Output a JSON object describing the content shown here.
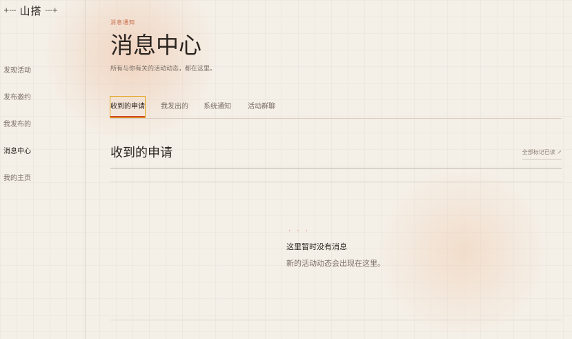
{
  "app": {
    "logo": "山搭",
    "logo_left": "+---",
    "logo_right": "---+"
  },
  "sidebar": {
    "items": [
      {
        "label": "发现活动",
        "active": false
      },
      {
        "label": "发布邀约",
        "active": false
      },
      {
        "label": "我发布的",
        "active": false
      },
      {
        "label": "消息中心",
        "active": true
      },
      {
        "label": "我的主页",
        "active": false
      }
    ]
  },
  "header": {
    "eyebrow": "消息通知",
    "title": "消息中心",
    "subtitle": "所有与你有关的活动动态，都在这里。"
  },
  "tabs": [
    {
      "label": "收到的申请",
      "active": true
    },
    {
      "label": "我发出的",
      "active": false
    },
    {
      "label": "系统通知",
      "active": false
    },
    {
      "label": "活动群聊",
      "active": false
    }
  ],
  "section": {
    "title": "收到的申请",
    "mark_all": "全部标记已读 ↗"
  },
  "empty": {
    "dots": "· · ·",
    "title": "这里暂时没有消息",
    "subtitle": "新的活动动态会出现在这里。"
  },
  "colors": {
    "accent": "#d04a2e",
    "focus": "#e2a51c",
    "background": "#f4efe7"
  }
}
